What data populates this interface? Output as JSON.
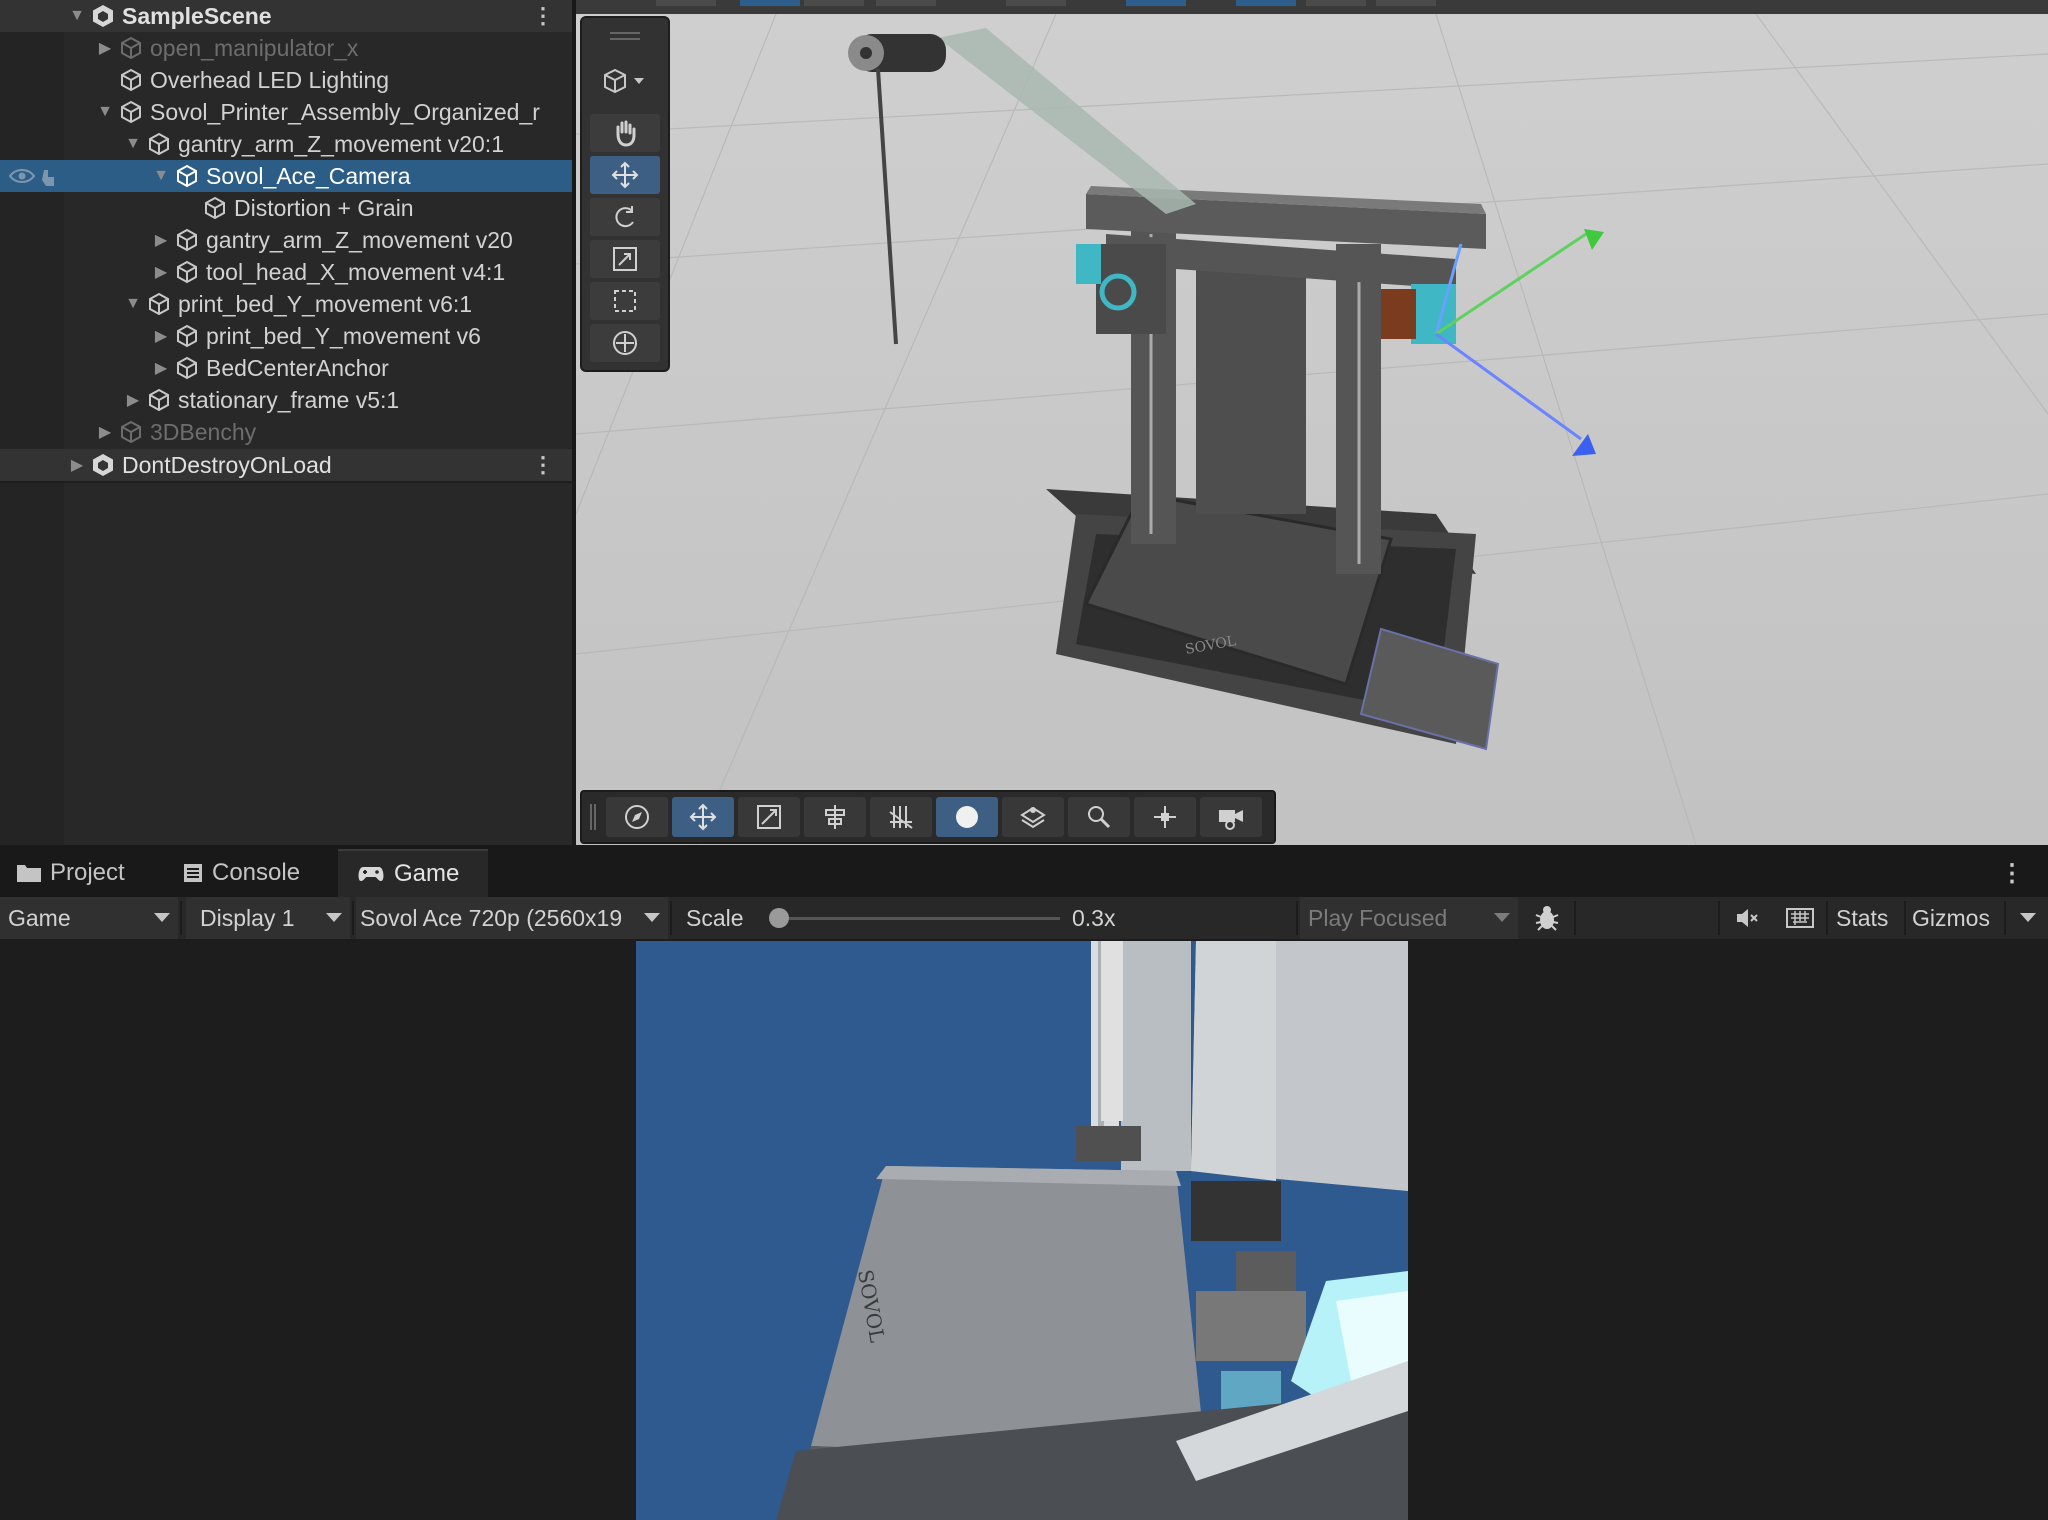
{
  "hierarchy": {
    "scene_name": "SampleScene",
    "items": [
      {
        "label": "open_manipulator_x"
      },
      {
        "label": "Overhead LED Lighting"
      },
      {
        "label": "Sovol_Printer_Assembly_Organized_r"
      },
      {
        "label": "gantry_arm_Z_movement v20:1"
      },
      {
        "label": "Sovol_Ace_Camera"
      },
      {
        "label": "Distortion + Grain"
      },
      {
        "label": "gantry_arm_Z_movement v20"
      },
      {
        "label": "tool_head_X_movement v4:1"
      },
      {
        "label": "print_bed_Y_movement v6:1"
      },
      {
        "label": "print_bed_Y_movement v6"
      },
      {
        "label": "BedCenterAnchor"
      },
      {
        "label": "stationary_frame v5:1"
      },
      {
        "label": "3DBenchy"
      }
    ],
    "dont_destroy": "DontDestroyOnLoad",
    "kebab": "⋮"
  },
  "scene_tools": [
    "view-tool",
    "hand-tool",
    "move-tool",
    "rotate-tool",
    "scale-tool",
    "rect-tool",
    "transform-tool"
  ],
  "overlay_tools": [
    "orbit",
    "move",
    "snap",
    "align",
    "grid",
    "shading",
    "layers",
    "search",
    "pivot",
    "camera"
  ],
  "tabs": {
    "project": "Project",
    "console": "Console",
    "game": "Game",
    "kebab": "⋮"
  },
  "game_toolbar": {
    "view_select": "Game",
    "display": "Display 1",
    "resolution": "Sovol Ace 720p (2560x19",
    "scale_label": "Scale",
    "scale_value": "0.3x",
    "scale_fraction": 0.03,
    "play_mode": "Play Focused",
    "stats": "Stats",
    "gizmos": "Gizmos"
  },
  "game_view": {
    "bed_brand": "SOVOL"
  },
  "colors": {
    "selection": "#2c5d87",
    "scene_bg": "#c7c7c7",
    "game_sky": "#2f5a8f",
    "accent_teal": "#3fb7c4"
  }
}
